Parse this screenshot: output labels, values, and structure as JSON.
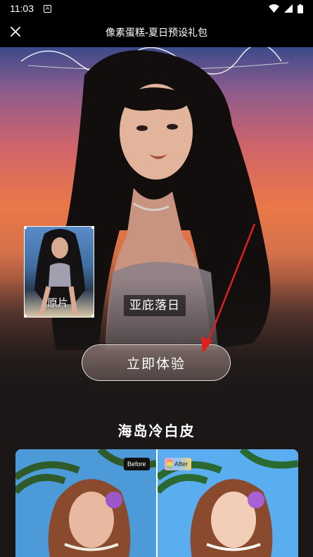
{
  "status_bar": {
    "time": "11:03",
    "notification_icon": "A"
  },
  "header": {
    "title": "像素蛋糕-夏日预设礼包"
  },
  "hero": {
    "preset_name": "亚庇落日",
    "original_label": "原片",
    "cta_label": "立即体验"
  },
  "section": {
    "title": "海岛冷白皮",
    "before_tag": "Before",
    "after_tag": "After"
  },
  "colors": {
    "annotation_arrow": "#e02020",
    "sunset_orange": "#ea7848",
    "sky_blue": "#4aa0e8"
  }
}
